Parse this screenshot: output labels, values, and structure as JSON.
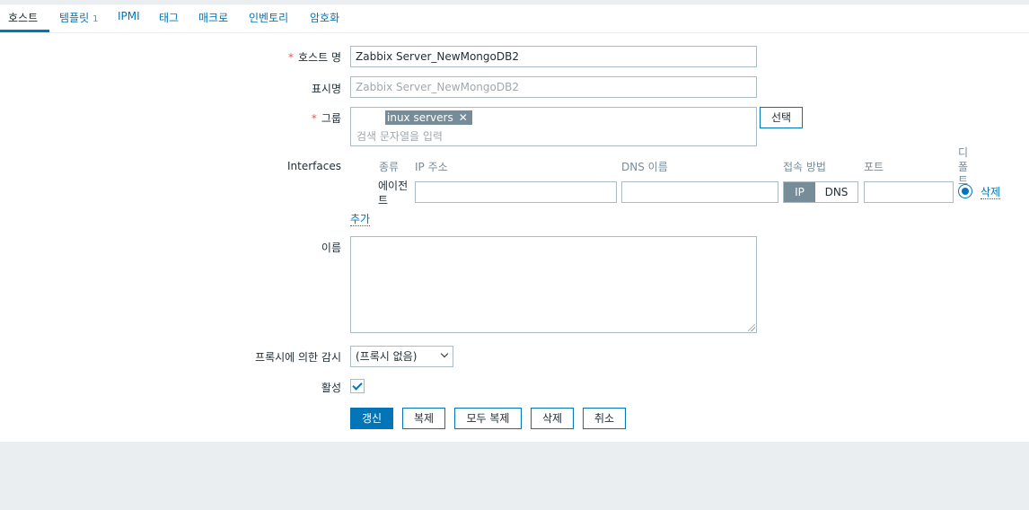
{
  "tabs": [
    {
      "label": "호스트"
    },
    {
      "label": "템플릿",
      "count": "1"
    },
    {
      "label": "IPMI"
    },
    {
      "label": "태그"
    },
    {
      "label": "매크로"
    },
    {
      "label": "인벤토리"
    },
    {
      "label": "암호화"
    }
  ],
  "form": {
    "host_name_label": "호스트 명",
    "host_name_value": "Zabbix Server_NewMongoDB2",
    "visible_name_label": "표시명",
    "visible_name_placeholder": "Zabbix Server_NewMongoDB2",
    "groups_label": "그룹",
    "group_chip": "inux servers",
    "groups_placeholder": "검색 문자열을 입력",
    "select_button": "선택",
    "interfaces_label": "Interfaces",
    "interfaces": {
      "headers": {
        "type": "종류",
        "ip": "IP 주소",
        "dns": "DNS 이름",
        "connect": "접속 방법",
        "port": "포트",
        "default_line1": "디",
        "default_line2": "폴",
        "default_line3": "트"
      },
      "row_type_line1": "에이전",
      "row_type_line2": "트",
      "ip_value": "",
      "dns_value": "",
      "connect_ip": "IP",
      "connect_dns": "DNS",
      "port_value": "",
      "remove_link": "삭제",
      "add_link": "추가"
    },
    "description_label": "이름",
    "proxy_label": "프록시에 의한 감시",
    "proxy_selected": "(프록시 없음)",
    "enabled_label": "활성",
    "required_mark": "*"
  },
  "buttons": {
    "update": "갱신",
    "clone": "복제",
    "full_clone": "모두 복제",
    "delete": "삭제",
    "cancel": "취소"
  },
  "colors": {
    "accent": "#0275b8",
    "required": "#e45959",
    "chip": "#768d99"
  }
}
